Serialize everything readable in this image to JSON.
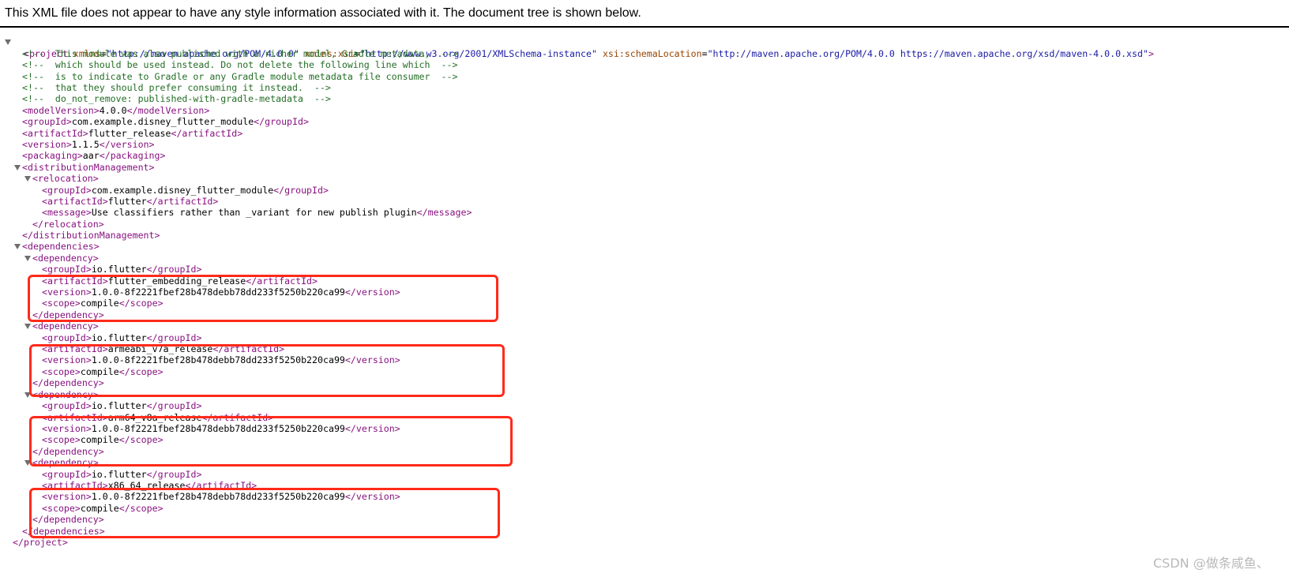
{
  "banner": {
    "message": "This XML file does not appear to have any style information associated with it. The document tree is shown below."
  },
  "xml": {
    "project_open": {
      "tag": "<project",
      "attrs": [
        {
          "name": "xmlns",
          "value": "\"http://maven.apache.org/POM/4.0.0\""
        },
        {
          "name": "xmlns:xsi",
          "value": "\"http://www.w3.org/2001/XMLSchema-instance\""
        },
        {
          "name": "xsi:schemaLocation",
          "value": "\"http://maven.apache.org/POM/4.0.0 https://maven.apache.org/xsd/maven-4.0.0.xsd\""
        }
      ],
      "close": ">"
    },
    "comments": [
      "<!--  This module was also published with a richer model, Gradle metadata,  -->",
      "<!--  which should be used instead. Do not delete the following line which  -->",
      "<!--  is to indicate to Gradle or any Gradle module metadata file consumer  -->",
      "<!--  that they should prefer consuming it instead.  -->",
      "<!--  do_not_remove: published-with-gradle-metadata  -->"
    ],
    "header_fields": [
      {
        "open": "<modelVersion>",
        "text": "4.0.0",
        "close": "</modelVersion>"
      },
      {
        "open": "<groupId>",
        "text": "com.example.disney_flutter_module",
        "close": "</groupId>"
      },
      {
        "open": "<artifactId>",
        "text": "flutter_release",
        "close": "</artifactId>"
      },
      {
        "open": "<version>",
        "text": "1.1.5",
        "close": "</version>"
      },
      {
        "open": "<packaging>",
        "text": "aar",
        "close": "</packaging>"
      }
    ],
    "distribution": {
      "open": "<distributionManagement>",
      "close": "</distributionManagement>",
      "relocation": {
        "open": "<relocation>",
        "close": "</relocation>",
        "fields": [
          {
            "open": "<groupId>",
            "text": "com.example.disney_flutter_module",
            "close": "</groupId>"
          },
          {
            "open": "<artifactId>",
            "text": "flutter",
            "close": "</artifactId>"
          },
          {
            "open": "<message>",
            "text": "Use classifiers rather than _variant for new publish plugin",
            "close": "</message>"
          }
        ]
      }
    },
    "dependencies": {
      "open": "<dependencies>",
      "close": "</dependencies>",
      "dep_open": "<dependency>",
      "dep_close": "</dependency>",
      "items": [
        {
          "fields": [
            {
              "open": "<groupId>",
              "text": "io.flutter",
              "close": "</groupId>"
            },
            {
              "open": "<artifactId>",
              "text": "flutter_embedding_release",
              "close": "</artifactId>"
            },
            {
              "open": "<version>",
              "text": "1.0.0-8f2221fbef28b478debb78dd233f5250b220ca99",
              "close": "</version>"
            },
            {
              "open": "<scope>",
              "text": "compile",
              "close": "</scope>"
            }
          ]
        },
        {
          "fields": [
            {
              "open": "<groupId>",
              "text": "io.flutter",
              "close": "</groupId>"
            },
            {
              "open": "<artifactId>",
              "text": "armeabi_v7a_release",
              "close": "</artifactId>"
            },
            {
              "open": "<version>",
              "text": "1.0.0-8f2221fbef28b478debb78dd233f5250b220ca99",
              "close": "</version>"
            },
            {
              "open": "<scope>",
              "text": "compile",
              "close": "</scope>"
            }
          ]
        },
        {
          "fields": [
            {
              "open": "<groupId>",
              "text": "io.flutter",
              "close": "</groupId>"
            },
            {
              "open": "<artifactId>",
              "text": "arm64_v8a_release",
              "close": "</artifactId>"
            },
            {
              "open": "<version>",
              "text": "1.0.0-8f2221fbef28b478debb78dd233f5250b220ca99",
              "close": "</version>"
            },
            {
              "open": "<scope>",
              "text": "compile",
              "close": "</scope>"
            }
          ]
        },
        {
          "fields": [
            {
              "open": "<groupId>",
              "text": "io.flutter",
              "close": "</groupId>"
            },
            {
              "open": "<artifactId>",
              "text": "x86_64_release",
              "close": "</artifactId>"
            },
            {
              "open": "<version>",
              "text": "1.0.0-8f2221fbef28b478debb78dd233f5250b220ca99",
              "close": "</version>"
            },
            {
              "open": "<scope>",
              "text": "compile",
              "close": "</scope>"
            }
          ]
        }
      ]
    },
    "project_close": "</project>"
  },
  "watermark": "CSDN @做条咸鱼、",
  "colors": {
    "tag": "#881280",
    "attr_name": "#994500",
    "attr_value": "#1a1aa6",
    "comment": "#236e25",
    "highlight_box": "#ff2a1a"
  },
  "icons": {
    "toggle": "triangle-down-icon"
  }
}
